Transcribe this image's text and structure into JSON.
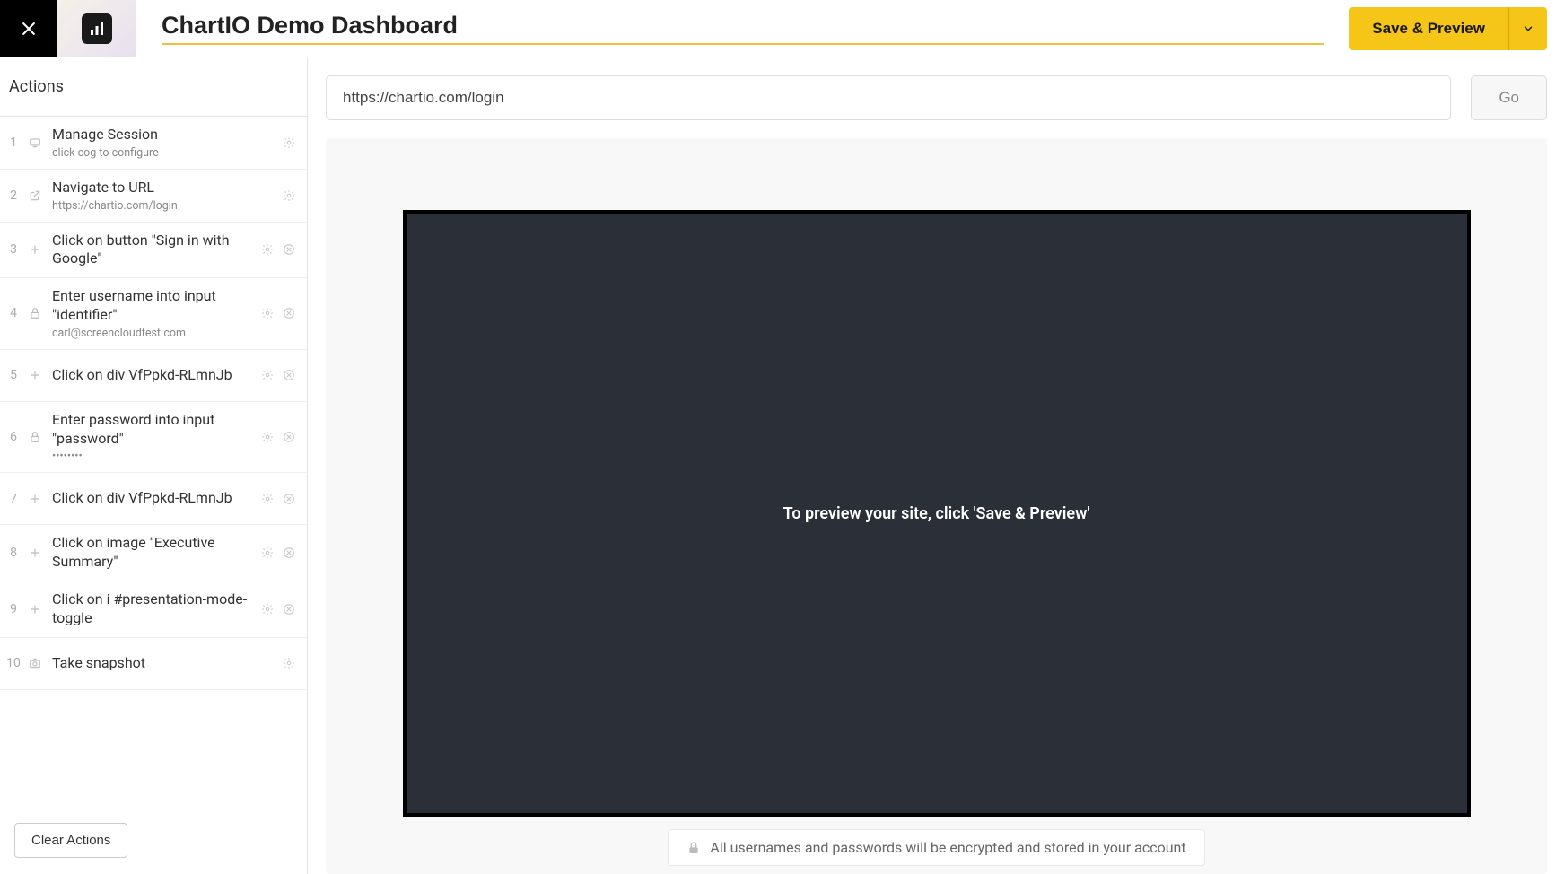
{
  "header": {
    "title_value": "ChartIO Demo Dashboard",
    "save_label": "Save & Preview"
  },
  "sidebar": {
    "title": "Actions",
    "clear_label": "Clear Actions",
    "items": [
      {
        "num": "1",
        "icon": "session",
        "title": "Manage Session",
        "sub": "click cog to configure",
        "gear": true,
        "remove": false
      },
      {
        "num": "2",
        "icon": "external",
        "title": "Navigate to URL",
        "sub": "https://chartio.com/login",
        "gear": true,
        "remove": false
      },
      {
        "num": "3",
        "icon": "plus",
        "title": "Click on button \"Sign in with Google\"",
        "sub": "",
        "gear": true,
        "remove": true
      },
      {
        "num": "4",
        "icon": "lock",
        "title": "Enter username into input \"identifier\"",
        "sub": "carl@screencloudtest.com",
        "gear": true,
        "remove": true
      },
      {
        "num": "5",
        "icon": "plus",
        "title": "Click on div VfPpkd-RLmnJb",
        "sub": "",
        "gear": true,
        "remove": true
      },
      {
        "num": "6",
        "icon": "lock",
        "title": "Enter password into input \"password\"",
        "sub": "••••••••",
        "gear": true,
        "remove": true
      },
      {
        "num": "7",
        "icon": "plus",
        "title": "Click on div VfPpkd-RLmnJb",
        "sub": "",
        "gear": true,
        "remove": true
      },
      {
        "num": "8",
        "icon": "plus",
        "title": "Click on image \"Executive Summary\"",
        "sub": "",
        "gear": true,
        "remove": true
      },
      {
        "num": "9",
        "icon": "plus",
        "title": "Click on i #presentation-mode-toggle",
        "sub": "",
        "gear": true,
        "remove": true
      },
      {
        "num": "10",
        "icon": "camera",
        "title": "Take snapshot",
        "sub": "",
        "gear": true,
        "remove": false
      }
    ]
  },
  "content": {
    "url_value": "https://chartio.com/login",
    "go_label": "Go",
    "preview_message": "To preview your site, click 'Save & Preview'",
    "encrypt_message": "All usernames and passwords will be encrypted and stored in your account"
  }
}
